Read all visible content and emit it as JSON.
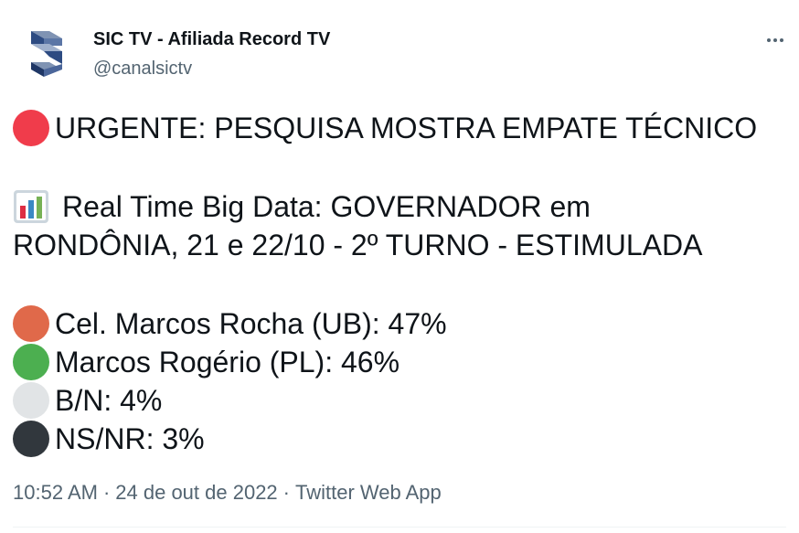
{
  "author": {
    "name": "SIC TV - Afiliada Record TV",
    "handle": "@canalsictv"
  },
  "tweet": {
    "headline": "URGENTE: PESQUISA MOSTRA EMPATE TÉCNICO",
    "poll_line1": "Real Time Big Data: GOVERNADOR em",
    "poll_line2": "RONDÔNIA, 21 e 22/10 - 2º TURNO - ESTIMULADA",
    "results": [
      {
        "text": "Cel. Marcos Rocha (UB): 47%",
        "color": "#e0694a"
      },
      {
        "text": "Marcos Rogério (PL): 46%",
        "color": "#4caf50"
      },
      {
        "text": "B/N: 4%",
        "color": "#e1e4e6"
      },
      {
        "text": "NS/NR: 3%",
        "color": "#31373d"
      }
    ],
    "red_circle_color": "#f03c4b"
  },
  "meta": {
    "time": "10:52 AM",
    "date": "24 de out de 2022",
    "source": "Twitter Web App",
    "separator": "·"
  },
  "icons": {
    "more": "more-horizontal-icon",
    "avatar": "sic-logo",
    "red_circle": "red-circle-emoji",
    "chart": "bar-chart-emoji"
  }
}
